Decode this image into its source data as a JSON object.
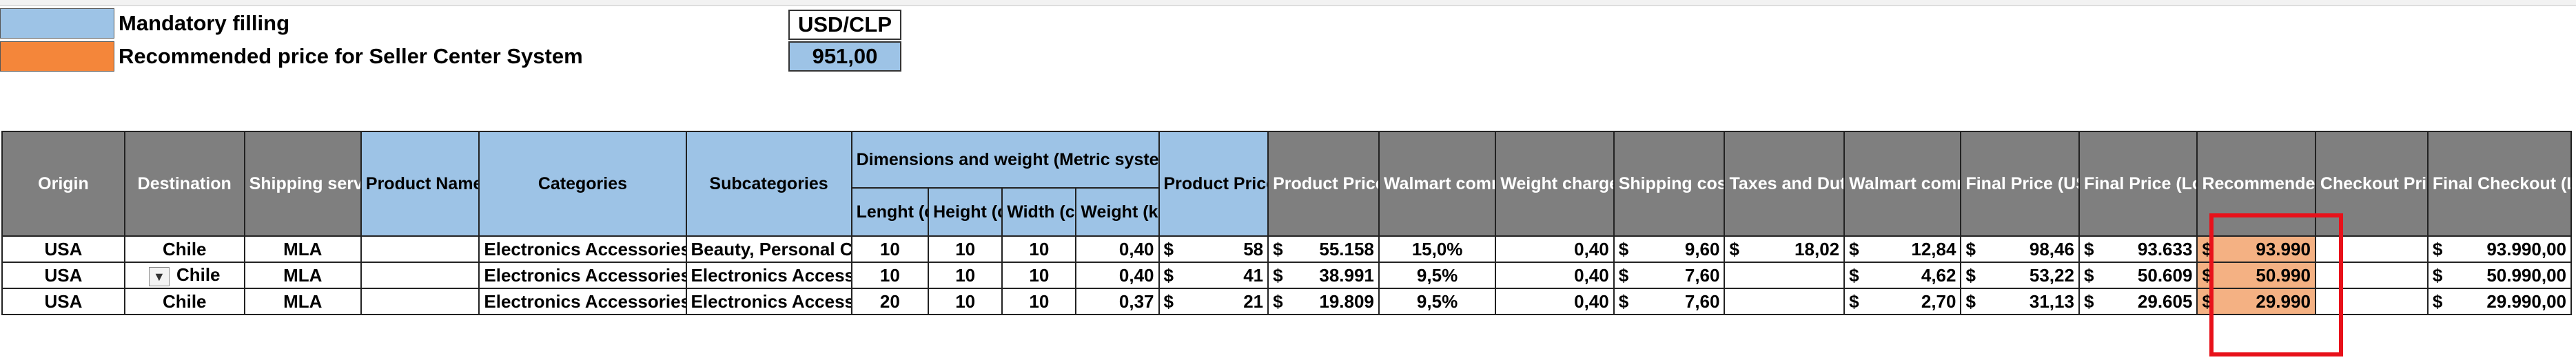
{
  "legend": {
    "mandatory_label": "Mandatory filling",
    "mandatory_color": "#9dc3e6",
    "recommended_label": "Recommended price for Seller Center System",
    "recommended_color": "#f4863a"
  },
  "currency": {
    "label": "USD/CLP",
    "rate": "951,00"
  },
  "headers": {
    "origin": "Origin",
    "destination": "Destination",
    "shipping_service": "Shipping service",
    "product_name": "Product Name/Reference (Optional)",
    "categories": "Categories",
    "subcategories": "Subcategories",
    "dimensions_group": "Dimensions and weight (Metric system)",
    "length": "Lenght (cm)",
    "height": "Height (cm)",
    "width": "Width (cm)",
    "weight": "Weight (kg)",
    "price_fob": "Product Price FOB (USD)",
    "price_local": "Product Price (Local currency)",
    "walmart_commission_pct": "Walmart commission %",
    "weight_chargeable": "Weight chargeable (kg)",
    "shipping_cost": "Shipping cost (USD)",
    "taxes": "Taxes and Duties (USD)",
    "walmart_commission_usd": "Walmart commission (USD)",
    "final_price_usd": "Final Price (USD)",
    "final_price_local": "Final Price (Local currency)",
    "recommended_price": "Recommended price for Seller Center",
    "checkout_priority": "Checkout Priority shipping Assumed",
    "final_checkout": "Final Checkout (Local currency)"
  },
  "rows": [
    {
      "origin": "USA",
      "destination": "Chile",
      "shipping_service": "MLA",
      "product_name": "",
      "category": "Electronics Accessories",
      "subcategory": "Beauty, Personal Care",
      "length": "10",
      "height": "10",
      "width": "10",
      "weight": "0,40",
      "fob_symbol": "$",
      "fob": "58",
      "local_symbol": "$",
      "local": "55.158",
      "commission_pct": "15,0%",
      "weight_chargeable": "0,40",
      "ship_symbol": "$",
      "ship": "9,60",
      "tax_symbol": "$",
      "tax": "18,02",
      "wc_symbol": "$",
      "wc": "12,84",
      "fp_symbol": "$",
      "fp_usd": "98,46",
      "fpl_symbol": "$",
      "fp_local": "93.633",
      "rec_symbol": "$",
      "recommended": "93.990",
      "checkout_priority": "",
      "fc_symbol": "$",
      "final_checkout": "93.990,00",
      "has_dropdown": false
    },
    {
      "origin": "USA",
      "destination": "Chile",
      "shipping_service": "MLA",
      "product_name": "",
      "category": "Electronics Accessories",
      "subcategory": "Electronics Accessories",
      "length": "10",
      "height": "10",
      "width": "10",
      "weight": "0,40",
      "fob_symbol": "$",
      "fob": "41",
      "local_symbol": "$",
      "local": "38.991",
      "commission_pct": "9,5%",
      "weight_chargeable": "0,40",
      "ship_symbol": "$",
      "ship": "7,60",
      "tax_symbol": "",
      "tax": "",
      "wc_symbol": "$",
      "wc": "4,62",
      "fp_symbol": "$",
      "fp_usd": "53,22",
      "fpl_symbol": "$",
      "fp_local": "50.609",
      "rec_symbol": "$",
      "recommended": "50.990",
      "checkout_priority": "",
      "fc_symbol": "$",
      "final_checkout": "50.990,00",
      "has_dropdown": true
    },
    {
      "origin": "USA",
      "destination": "Chile",
      "shipping_service": "MLA",
      "product_name": "",
      "category": "Electronics Accessories",
      "subcategory": "Electronics Accessories",
      "length": "20",
      "height": "10",
      "width": "10",
      "weight": "0,37",
      "fob_symbol": "$",
      "fob": "21",
      "local_symbol": "$",
      "local": "19.809",
      "commission_pct": "9,5%",
      "weight_chargeable": "0,40",
      "ship_symbol": "$",
      "ship": "7,60",
      "tax_symbol": "",
      "tax": "",
      "wc_symbol": "$",
      "wc": "2,70",
      "fp_symbol": "$",
      "fp_usd": "31,13",
      "fpl_symbol": "$",
      "fp_local": "29.605",
      "rec_symbol": "$",
      "recommended": "29.990",
      "checkout_priority": "",
      "fc_symbol": "$",
      "final_checkout": "29.990,00",
      "has_dropdown": false
    }
  ],
  "dropdown_icon": "chevron-down-icon",
  "highlight_color": "#e8111a"
}
